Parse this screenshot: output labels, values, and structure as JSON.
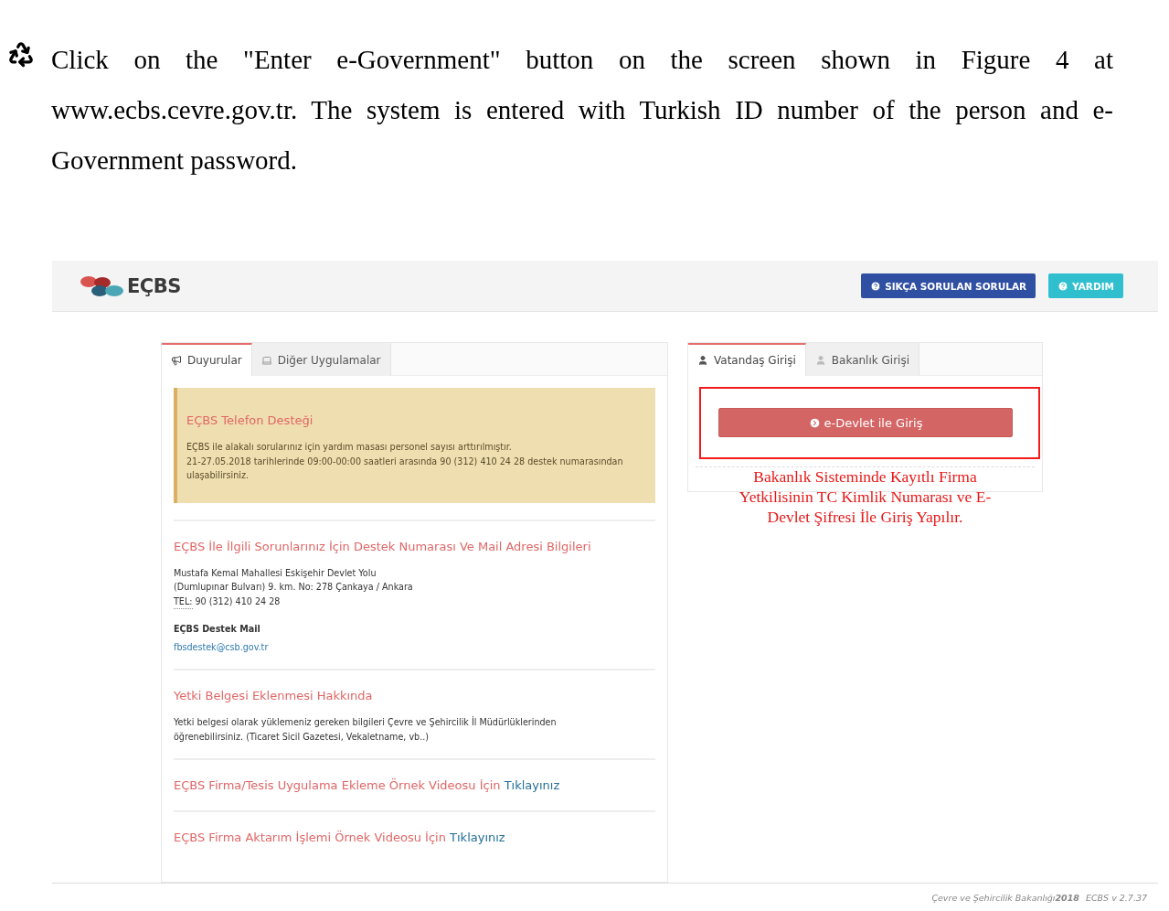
{
  "document": {
    "paragraph": "Click on the \"Enter e-Government\" button on the screen shown in Figure 4 at www.ecbs.cevre.gov.tr. The system is entered with Turkish ID number of the person and e-Government password."
  },
  "header": {
    "logo_text": "EÇBS",
    "buttons": [
      {
        "label": "SIKÇA SORULAN SORULAR",
        "kind": "primary"
      },
      {
        "label": "YARDIM",
        "kind": "info"
      }
    ]
  },
  "left_panel": {
    "tabs": [
      {
        "label": "Duyurular",
        "kind": "megaphone",
        "selected": true
      },
      {
        "label": "Diğer Uygulamalar",
        "kind": "laptop",
        "selected": false
      }
    ],
    "alert": {
      "title": "EÇBS Telefon Desteği",
      "lines": [
        "EÇBS ile alakalı sorularınız için yardım masası personel sayısı arttırılmıştır.",
        "21-27.05.2018 tarihlerinde 09:00-00:00 saatleri arasında 90 (312) 410 24 28 destek numarasından ulaşabilirsiniz."
      ]
    },
    "sections": [
      {
        "kind": "contact",
        "title": "EÇBS İle İlgili Sorunlarınız İçin Destek Numarası Ve Mail Adresi Bilgileri",
        "address": [
          "Mustafa Kemal Mahallesi Eskişehir Devlet Yolu",
          "(Dumlupınar Bulvarı) 9. km. No: 278 Çankaya / Ankara"
        ],
        "tel_label": "TEL:",
        "tel": "90 (312) 410 24 28",
        "mail_label": "EÇBS Destek Mail",
        "mail": "fbsdestek@csb.gov.tr"
      },
      {
        "kind": "text",
        "title": "Yetki Belgesi Eklenmesi Hakkında",
        "text": "Yetki belgesi olarak yüklemeniz gereken bilgileri Çevre ve Şehircilik İl Müdürlüklerinden öğrenebilirsiniz. (Ticaret Sicil Gazetesi, Vekaletname, vb..)"
      },
      {
        "kind": "link",
        "title": "EÇBS Firma/Tesis Uygulama Ekleme Örnek Videosu İçin",
        "link": "Tıklayınız"
      },
      {
        "kind": "link",
        "title": "EÇBS Firma Aktarım İşlemi Örnek Videosu İçin",
        "link": "Tıklayınız"
      }
    ]
  },
  "right_panel": {
    "tabs": [
      {
        "label": "Vatandaş Girişi",
        "selected": true
      },
      {
        "label": "Bakanlık Girişi",
        "selected": false
      }
    ],
    "login_button": "e-Devlet ile Giriş",
    "annotation": "Bakanlık Sisteminde Kayıtlı Firma Yetkilisinin TC Kimlik Numarası ve E-Devlet Şifresi İle Giriş Yapılır."
  },
  "footer": {
    "org": "Çevre ve Şehircilik Bakanlığı",
    "year": "2018",
    "version": "ECBS v 2.7.37"
  }
}
